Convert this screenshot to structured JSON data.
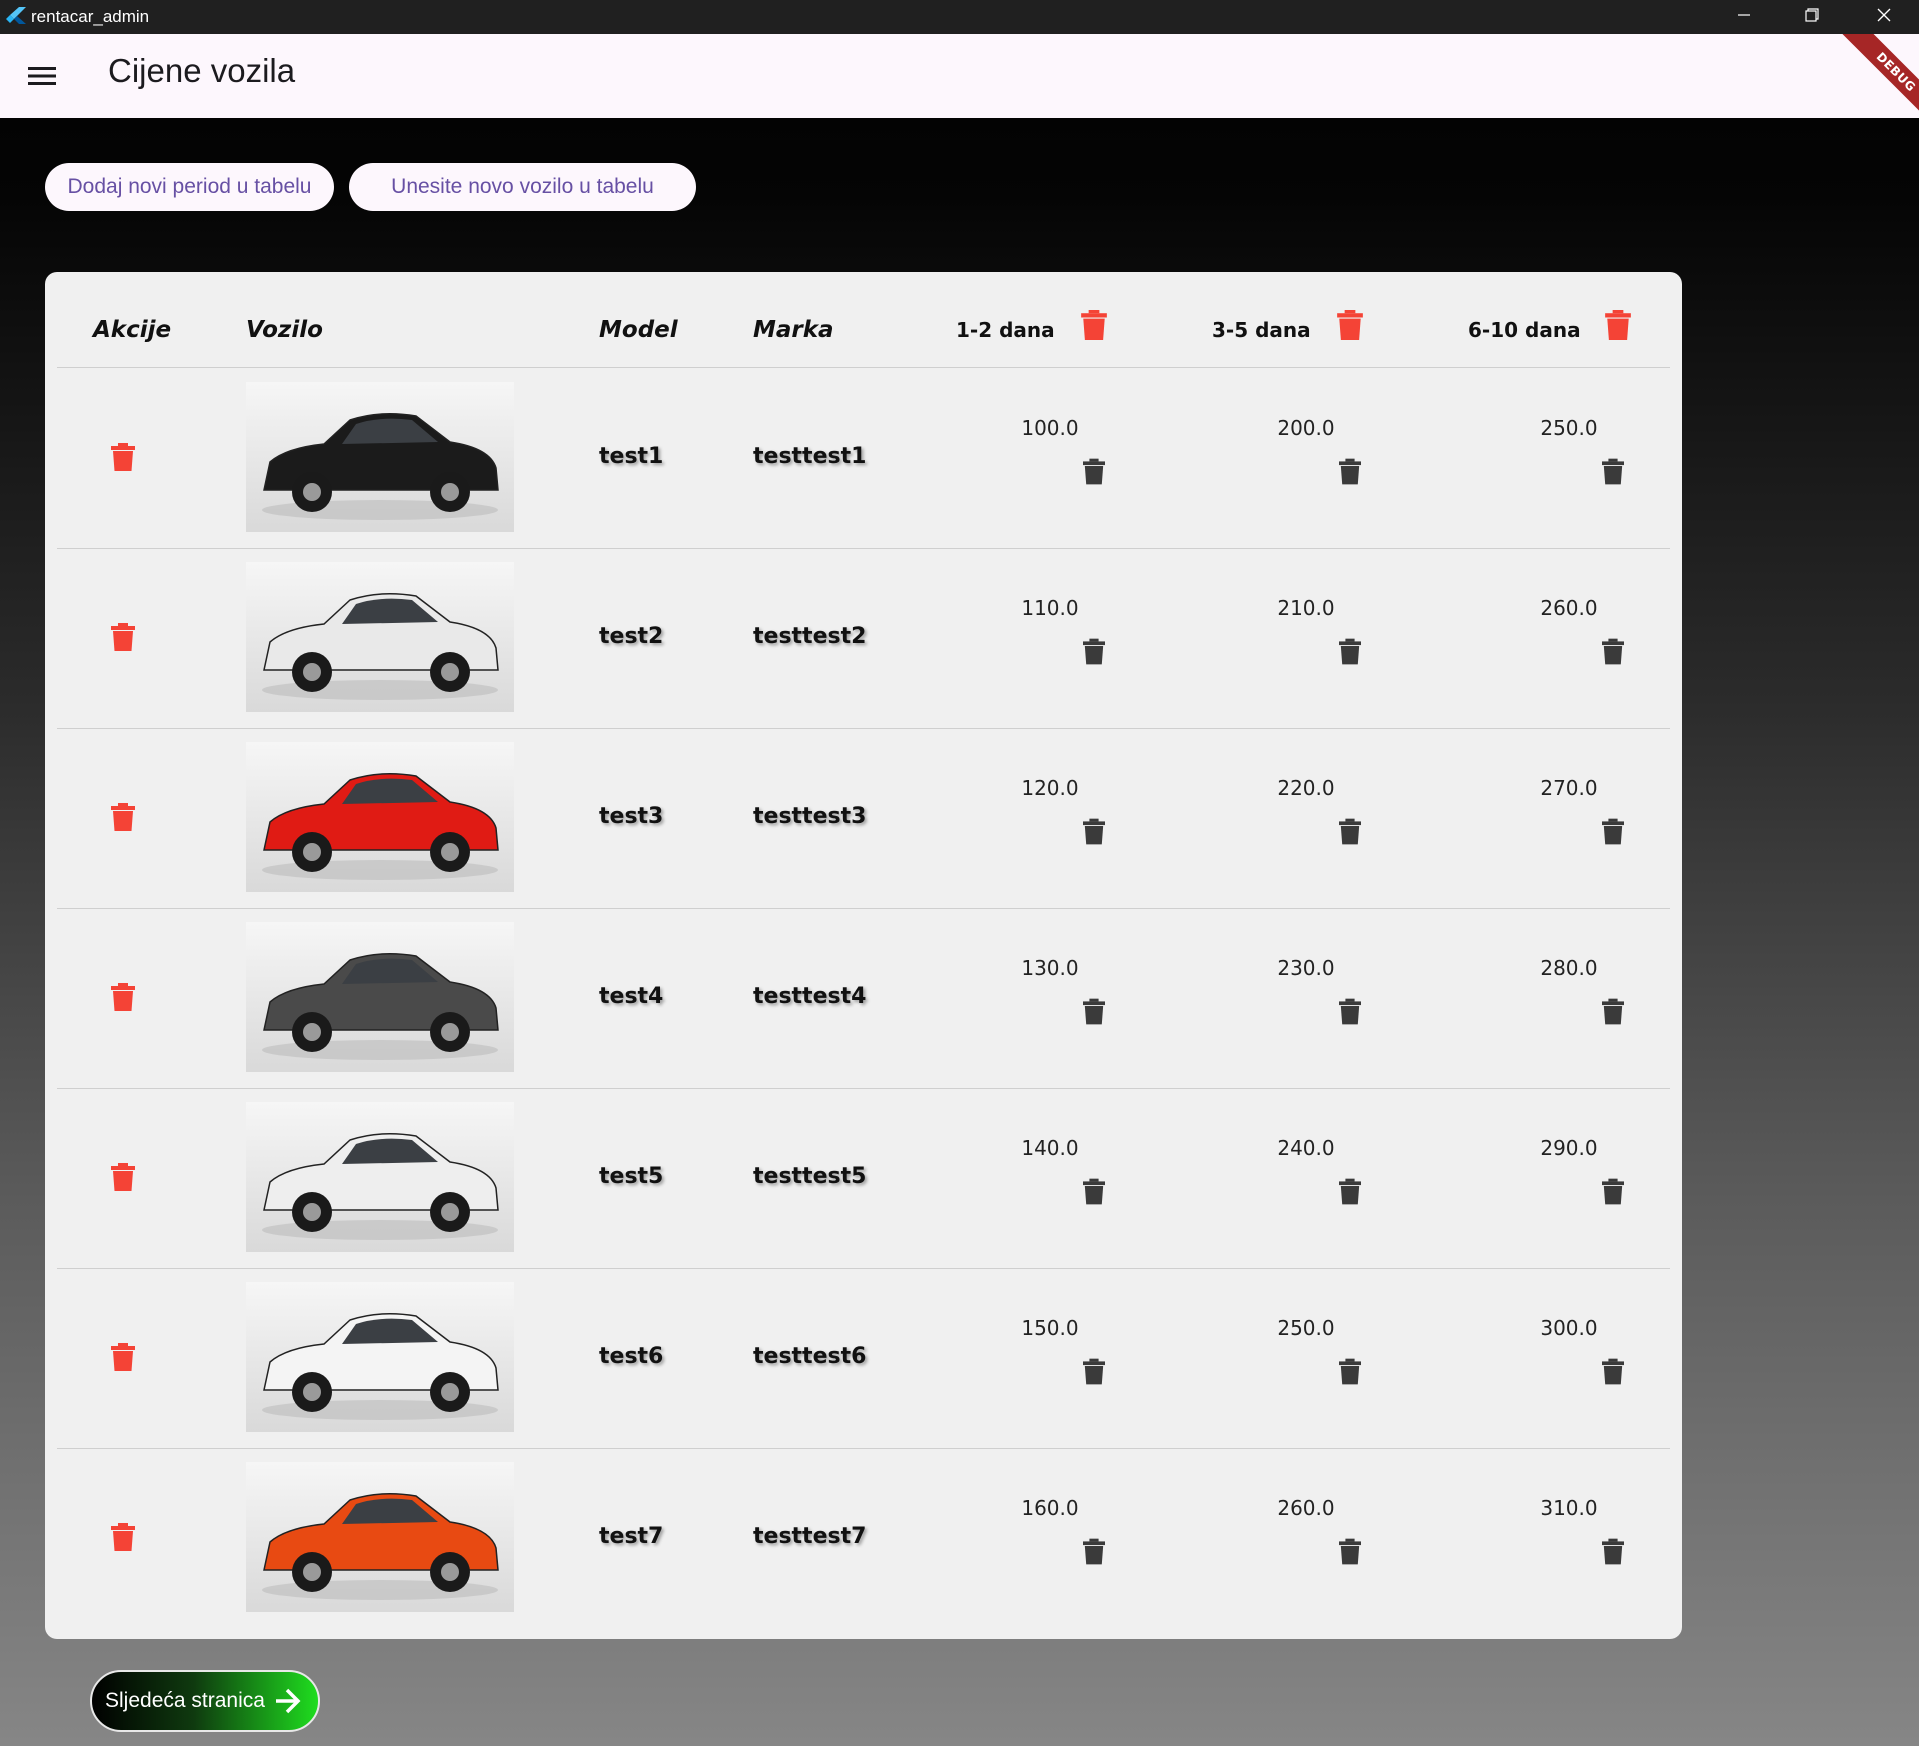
{
  "window": {
    "title": "rentacar_admin"
  },
  "appbar": {
    "title": "Cijene vozila",
    "debug_label": "DEBUG"
  },
  "actions": {
    "add_period": "Dodaj novi period u tabelu",
    "add_vehicle": "Unesite novo vozilo u tabelu"
  },
  "table": {
    "headers": {
      "actions": "Akcije",
      "vehicle": "Vozilo",
      "model": "Model",
      "brand": "Marka",
      "periods": [
        "1-2 dana",
        "3-5 dana",
        "6-10 dana"
      ]
    },
    "rows": [
      {
        "model": "test1",
        "brand": "testtest1",
        "prices": [
          "100.0",
          "200.0",
          "250.0"
        ],
        "car_color": "#1b1b1b"
      },
      {
        "model": "test2",
        "brand": "testtest2",
        "prices": [
          "110.0",
          "210.0",
          "260.0"
        ],
        "car_color": "#e9e9e9"
      },
      {
        "model": "test3",
        "brand": "testtest3",
        "prices": [
          "120.0",
          "220.0",
          "270.0"
        ],
        "car_color": "#e01b14"
      },
      {
        "model": "test4",
        "brand": "testtest4",
        "prices": [
          "130.0",
          "230.0",
          "280.0"
        ],
        "car_color": "#4a4a4a"
      },
      {
        "model": "test5",
        "brand": "testtest5",
        "prices": [
          "140.0",
          "240.0",
          "290.0"
        ],
        "car_color": "#eeeeee"
      },
      {
        "model": "test6",
        "brand": "testtest6",
        "prices": [
          "150.0",
          "250.0",
          "300.0"
        ],
        "car_color": "#f4f4f4"
      },
      {
        "model": "test7",
        "brand": "testtest7",
        "prices": [
          "160.0",
          "260.0",
          "310.0"
        ],
        "car_color": "#e84a12"
      }
    ]
  },
  "pagination": {
    "next_label": "Sljedeća stranica"
  },
  "colors": {
    "delete_red": "#f44336",
    "delete_dark": "#3a3a3a",
    "accent_purple": "#6750a4",
    "appbar_bg": "#fdf7fd",
    "card_bg": "#f0f0f0"
  },
  "icons": [
    "app-logo-icon",
    "minimize-icon",
    "restore-icon",
    "close-icon",
    "menu-icon",
    "trash-icon",
    "arrow-right-icon"
  ]
}
